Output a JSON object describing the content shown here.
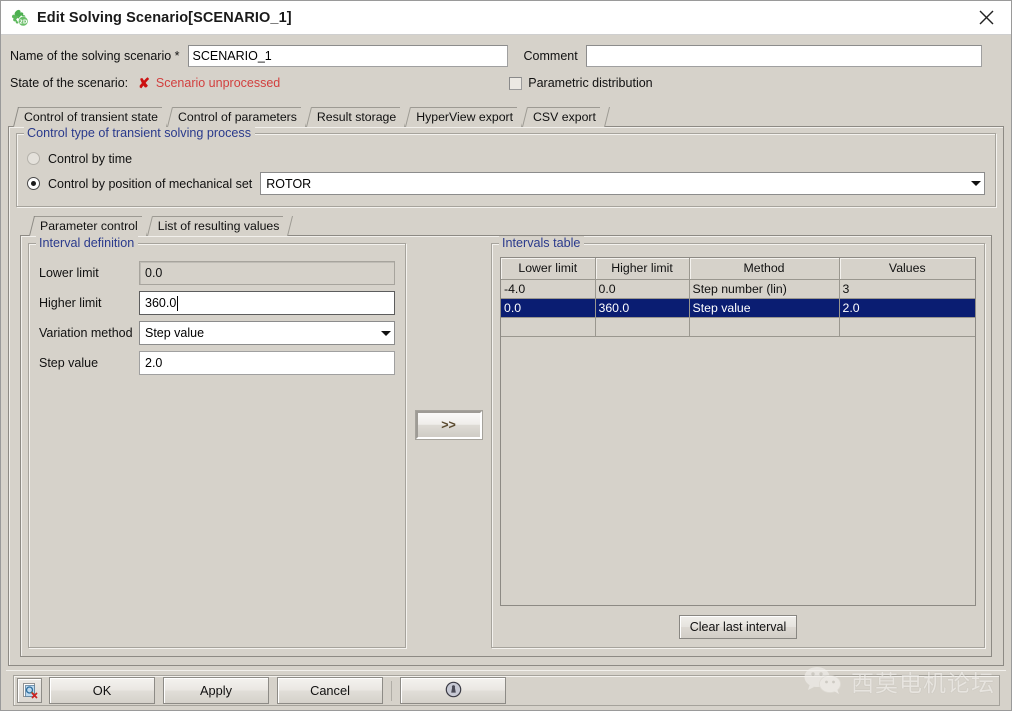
{
  "window": {
    "title": "Edit Solving Scenario[SCENARIO_1]",
    "icon": "flux-2d-icon",
    "close_label": "close-icon"
  },
  "header": {
    "name_label": "Name of the solving scenario *",
    "name_value": "SCENARIO_1",
    "comment_label": "Comment",
    "comment_value": "",
    "state_label": "State of the scenario:",
    "state_mark": "✘",
    "state_value": "Scenario unprocessed",
    "state_color": "#d2403f",
    "parametric_label": "Parametric distribution",
    "parametric_checked": false
  },
  "tabs": [
    {
      "label": "Control of transient state",
      "active": true
    },
    {
      "label": "Control of parameters",
      "active": false
    },
    {
      "label": "Result storage",
      "active": false
    },
    {
      "label": "HyperView export",
      "active": false
    },
    {
      "label": "CSV export",
      "active": false
    }
  ],
  "control_type": {
    "group_label": "Control type of transient solving process",
    "group_label_color": "#2a3a8c",
    "option_time": "Control by time",
    "option_time_selected": false,
    "option_position": "Control by position of mechanical set",
    "option_position_selected": true,
    "mechanical_set_value": "ROTOR"
  },
  "subtabs": [
    {
      "label": "Parameter control",
      "active": true
    },
    {
      "label": "List of resulting values",
      "active": false
    }
  ],
  "interval_definition": {
    "group_label": "Interval definition",
    "fields": [
      {
        "label": "Lower limit",
        "value": "0.0",
        "type": "readonly"
      },
      {
        "label": "Higher limit",
        "value": "360.0",
        "type": "editing"
      },
      {
        "label": "Variation method",
        "value": "Step value",
        "type": "combo"
      },
      {
        "label": "Step value",
        "value": "2.0",
        "type": "text"
      }
    ]
  },
  "transfer_button": {
    "label": ">>"
  },
  "intervals_table": {
    "group_label": "Intervals table",
    "columns": [
      "Lower limit",
      "Higher limit",
      "Method",
      "Values"
    ],
    "rows": [
      {
        "cells": [
          "-4.0",
          "0.0",
          "Step number (lin)",
          "3"
        ],
        "selected": false
      },
      {
        "cells": [
          "0.0",
          "360.0",
          "Step value",
          "2.0"
        ],
        "selected": true
      },
      {
        "cells": [
          "",
          "",
          "",
          ""
        ],
        "selected": false
      }
    ],
    "selection_color": "#0a1d72",
    "clear_button": "Clear last interval"
  },
  "footer": {
    "icon_button": "scenario-delete-icon",
    "buttons": [
      "OK",
      "Apply",
      "Cancel"
    ],
    "help_button": "help-icon"
  },
  "watermark": {
    "text": "西莫电机论坛",
    "logo": "wechat-icon"
  }
}
